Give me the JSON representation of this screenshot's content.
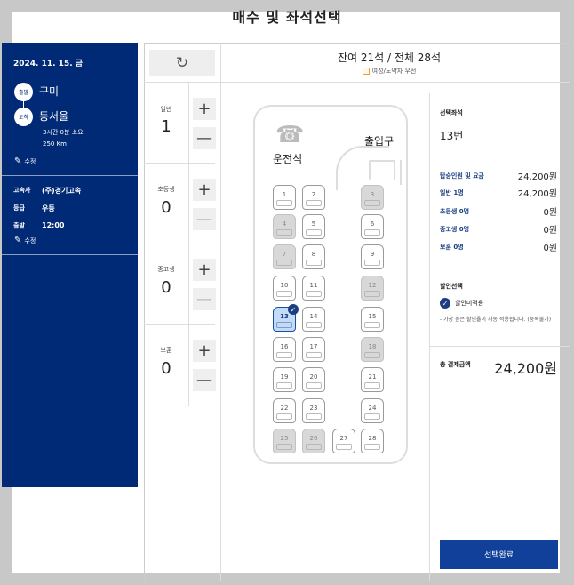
{
  "title": "매수 및 좌석선택",
  "trip": {
    "date": "2024. 11. 15. 금",
    "depart_badge": "출발",
    "depart_city": "구미",
    "arrive_badge": "도착",
    "arrive_city": "동서울",
    "duration": "3시간 0분 소요",
    "distance": "250 Km",
    "edit_label": "수정"
  },
  "bus_info": {
    "company_label": "고속사",
    "company": "(주)경기고속",
    "grade_label": "등급",
    "grade": "우등",
    "depart_label": "출발",
    "depart_time": "12:00",
    "edit_label": "수정"
  },
  "seat_header": {
    "remaining": "잔여 21석 / 전체 28석",
    "legend": "여성/노약자 우선",
    "refresh_icon": "refresh-icon"
  },
  "categories": [
    {
      "label": "일반",
      "count": "1",
      "plus": "+",
      "minus": "—"
    },
    {
      "label": "초등생",
      "count": "0",
      "plus": "+",
      "minus": "—"
    },
    {
      "label": "중고생",
      "count": "0",
      "plus": "+",
      "minus": "—"
    },
    {
      "label": "보훈",
      "count": "0",
      "plus": "+",
      "minus": "—"
    }
  ],
  "bus_map": {
    "driver_label": "운전석",
    "door_label": "출입구"
  },
  "seats": [
    {
      "no": "1",
      "state": "avail"
    },
    {
      "no": "2",
      "state": "avail"
    },
    {
      "no": "3",
      "state": "sold"
    },
    {
      "no": "4",
      "state": "sold"
    },
    {
      "no": "5",
      "state": "avail"
    },
    {
      "no": "6",
      "state": "avail"
    },
    {
      "no": "7",
      "state": "sold"
    },
    {
      "no": "8",
      "state": "avail"
    },
    {
      "no": "9",
      "state": "avail"
    },
    {
      "no": "10",
      "state": "avail"
    },
    {
      "no": "11",
      "state": "avail"
    },
    {
      "no": "12",
      "state": "sold"
    },
    {
      "no": "13",
      "state": "selected"
    },
    {
      "no": "14",
      "state": "avail"
    },
    {
      "no": "15",
      "state": "avail"
    },
    {
      "no": "16",
      "state": "avail"
    },
    {
      "no": "17",
      "state": "avail"
    },
    {
      "no": "18",
      "state": "sold"
    },
    {
      "no": "19",
      "state": "avail"
    },
    {
      "no": "20",
      "state": "avail"
    },
    {
      "no": "21",
      "state": "avail"
    },
    {
      "no": "22",
      "state": "avail"
    },
    {
      "no": "23",
      "state": "avail"
    },
    {
      "no": "24",
      "state": "avail"
    },
    {
      "no": "25",
      "state": "sold"
    },
    {
      "no": "26",
      "state": "sold"
    },
    {
      "no": "27",
      "state": "avail"
    },
    {
      "no": "28",
      "state": "avail"
    }
  ],
  "summary": {
    "selected_label": "선택좌석",
    "selected_value": "13번",
    "fare_label": "탑승인원 및 요금",
    "fare_total": "24,200원",
    "rows": [
      {
        "label": "일반 1명",
        "value": "24,200원"
      },
      {
        "label": "초등생 0명",
        "value": "0원"
      },
      {
        "label": "중고생 0명",
        "value": "0원"
      },
      {
        "label": "보훈 0명",
        "value": "0원"
      }
    ],
    "discount_label": "할인선택",
    "discount_option": "할인미적용",
    "discount_note": "- 가장 높은 할인율이 자동 적용됩니다. (중복불가)",
    "total_label": "총 결제금액",
    "total_value": "24,200원",
    "confirm_button": "선택완료"
  }
}
